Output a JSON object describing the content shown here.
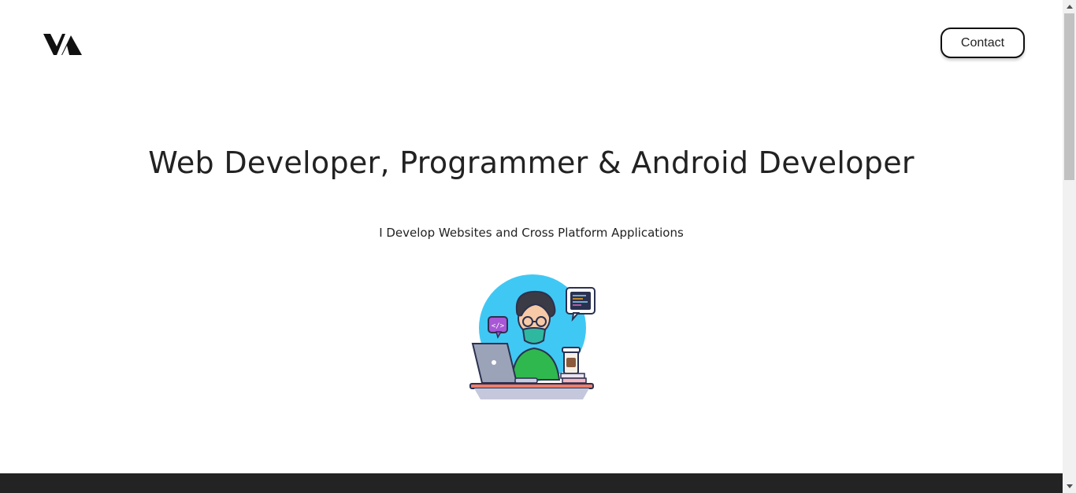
{
  "header": {
    "logo_icon": "va-logo-icon",
    "contact_label": "Contact"
  },
  "hero": {
    "title": "Web Developer, Programmer & Android Developer",
    "subtitle": "I Develop Websites and Cross Platform Applications",
    "illustration_icon": "developer-at-laptop-illustration"
  },
  "colors": {
    "text": "#222222",
    "footer": "#232323",
    "illustration_circle": "#40c8f4",
    "shirt": "#2fb84e"
  },
  "scrollbar": {
    "up_icon": "scroll-up-arrow-icon",
    "down_icon": "scroll-down-arrow-icon"
  }
}
